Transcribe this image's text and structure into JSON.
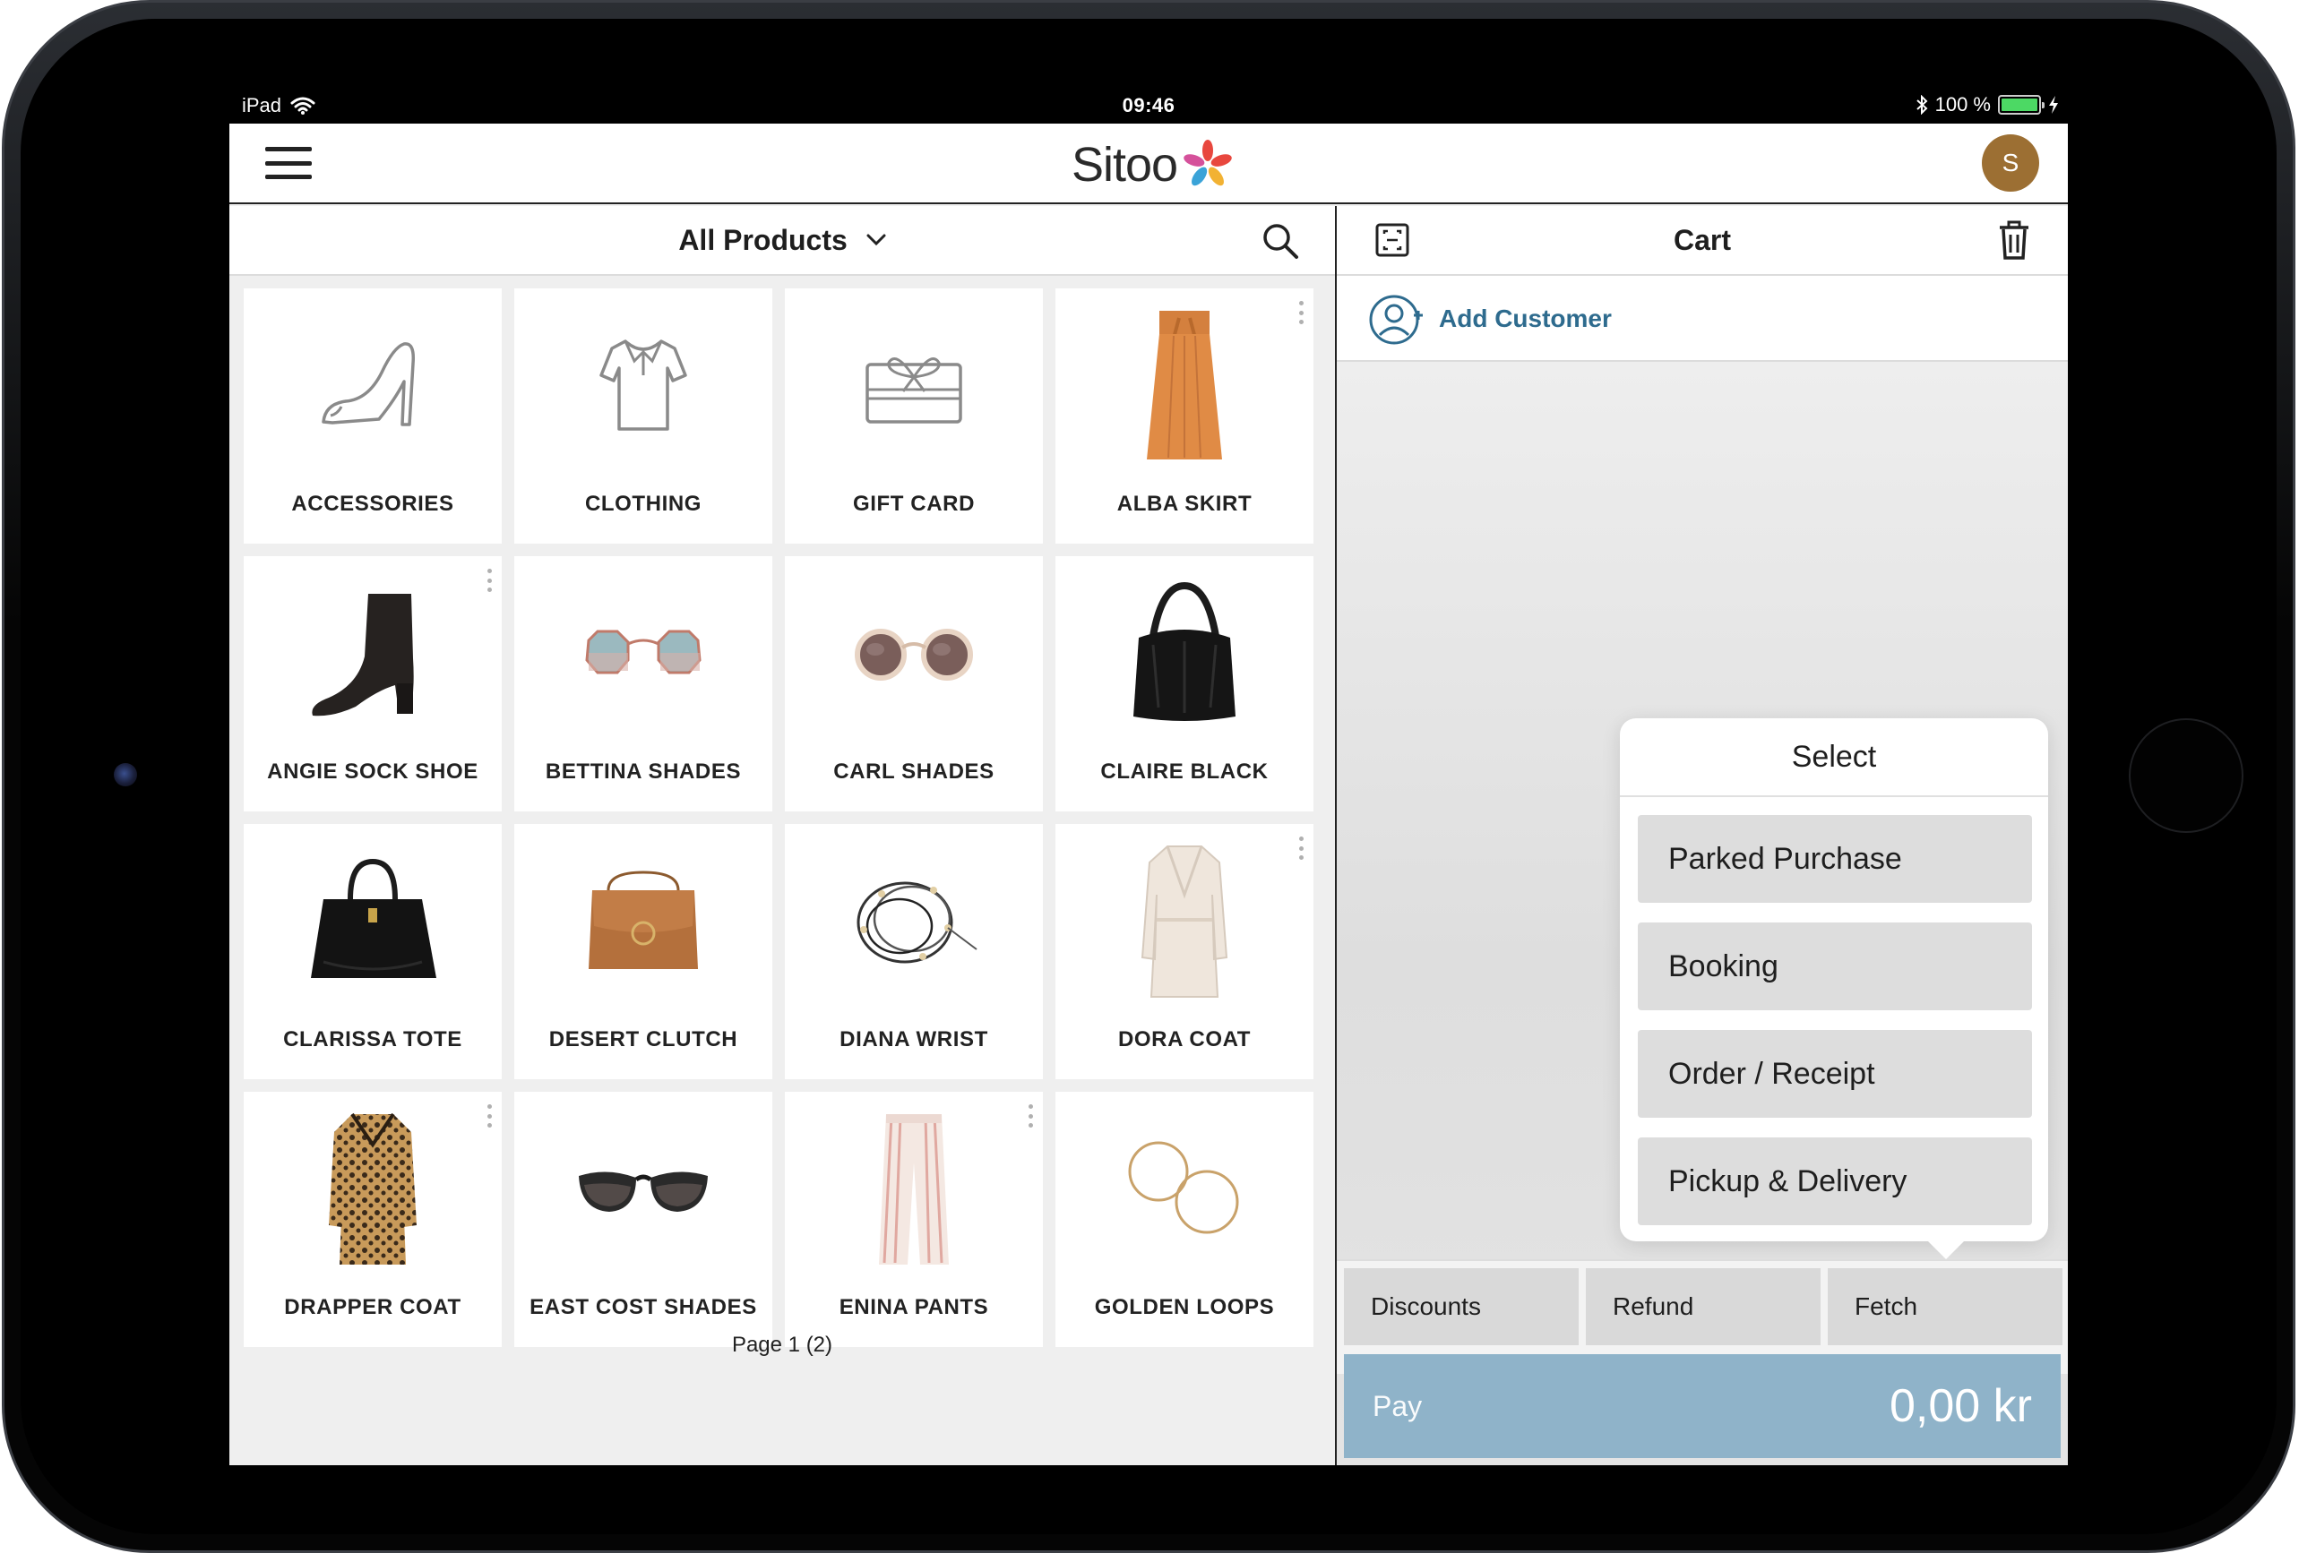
{
  "status_bar": {
    "device": "iPad",
    "time": "09:46",
    "battery": "100 %"
  },
  "app_bar": {
    "logo_text": "Sitoo",
    "avatar_initial": "S"
  },
  "products": {
    "filter_label": "All Products",
    "tiles": [
      {
        "label": "ACCESSORIES",
        "icon": "high-heel-shoe-icon"
      },
      {
        "label": "CLOTHING",
        "icon": "polo-shirt-icon"
      },
      {
        "label": "GIFT CARD",
        "icon": "gift-card-icon"
      },
      {
        "label": "ALBA SKIRT",
        "icon": "orange-skirt-image"
      },
      {
        "label": "ANGIE SOCK SHOE",
        "icon": "black-ankle-boot-image"
      },
      {
        "label": "BETTINA SHADES",
        "icon": "octagon-sunglasses-image"
      },
      {
        "label": "CARL SHADES",
        "icon": "round-sunglasses-image"
      },
      {
        "label": "CLAIRE BLACK",
        "icon": "black-hobo-bag-image"
      },
      {
        "label": "CLARISSA TOTE",
        "icon": "black-tote-bag-image"
      },
      {
        "label": "DESERT CLUTCH",
        "icon": "tan-clutch-bag-image"
      },
      {
        "label": "DIANA WRIST",
        "icon": "beaded-bracelet-image"
      },
      {
        "label": "DORA COAT",
        "icon": "cream-coat-image"
      },
      {
        "label": "DRAPPER COAT",
        "icon": "leopard-coat-image"
      },
      {
        "label": "EAST COST SHADES",
        "icon": "cat-eye-sunglasses-image"
      },
      {
        "label": "ENINA PANTS",
        "icon": "striped-pants-image"
      },
      {
        "label": "GOLDEN LOOPS",
        "icon": "hoop-earrings-image"
      }
    ],
    "pager": "Page 1 (2)"
  },
  "cart": {
    "title": "Cart",
    "add_customer": "Add Customer"
  },
  "popover": {
    "title": "Select",
    "items": [
      "Parked Purchase",
      "Booking",
      "Order / Receipt",
      "Pickup & Delivery"
    ]
  },
  "actions": {
    "discounts": "Discounts",
    "refund": "Refund",
    "fetch": "Fetch"
  },
  "pay": {
    "label": "Pay",
    "amount": "0,00 kr"
  },
  "colors": {
    "accent_link": "#2e6b8e",
    "pay_button": "#8fb3c9",
    "avatar": "#9c6f33"
  }
}
